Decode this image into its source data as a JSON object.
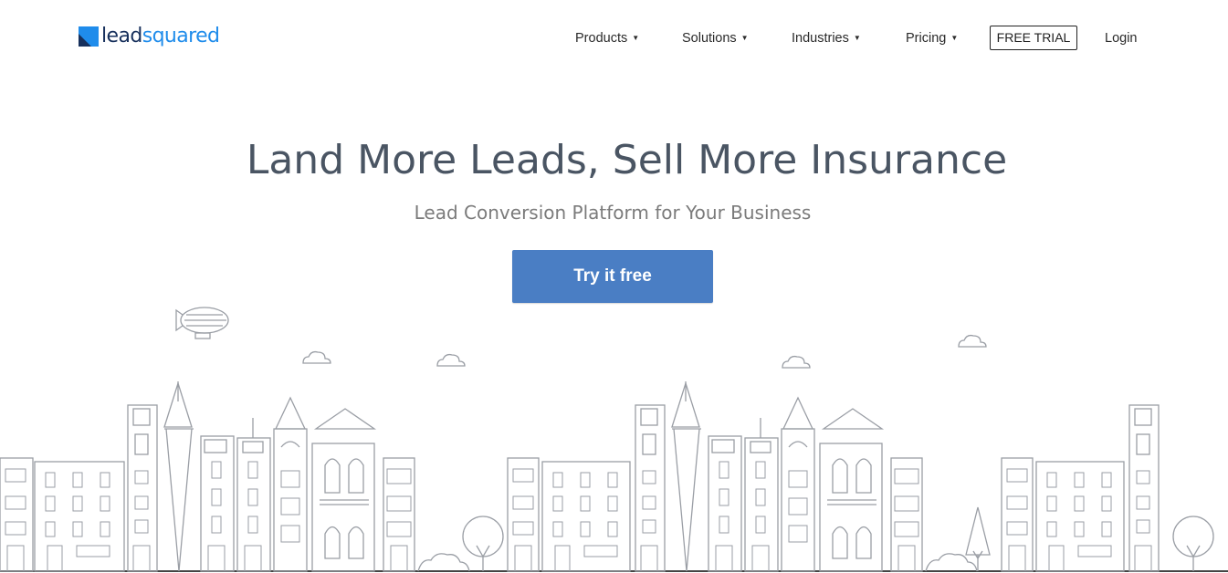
{
  "header": {
    "logo": {
      "part1": "lead",
      "part2": "squared"
    },
    "nav": [
      {
        "label": "Products",
        "caret": "▼"
      },
      {
        "label": "Solutions",
        "caret": "▼"
      },
      {
        "label": "Industries",
        "caret": "▼"
      },
      {
        "label": "Pricing",
        "caret": "▼"
      }
    ],
    "free_trial": "FREE TRIAL",
    "login": "Login"
  },
  "hero": {
    "title": "Land More Leads, Sell More Insurance",
    "subtitle": "Lead Conversion Platform for Your Business",
    "cta": "Try it free"
  },
  "colors": {
    "brand_blue": "#1f8ceb",
    "brand_navy": "#17305c",
    "cta": "#4a7ec4",
    "title": "#4a5563",
    "line_art": "#9a9ea5"
  },
  "illustration": {
    "icon": "city-skyline-line-art"
  }
}
